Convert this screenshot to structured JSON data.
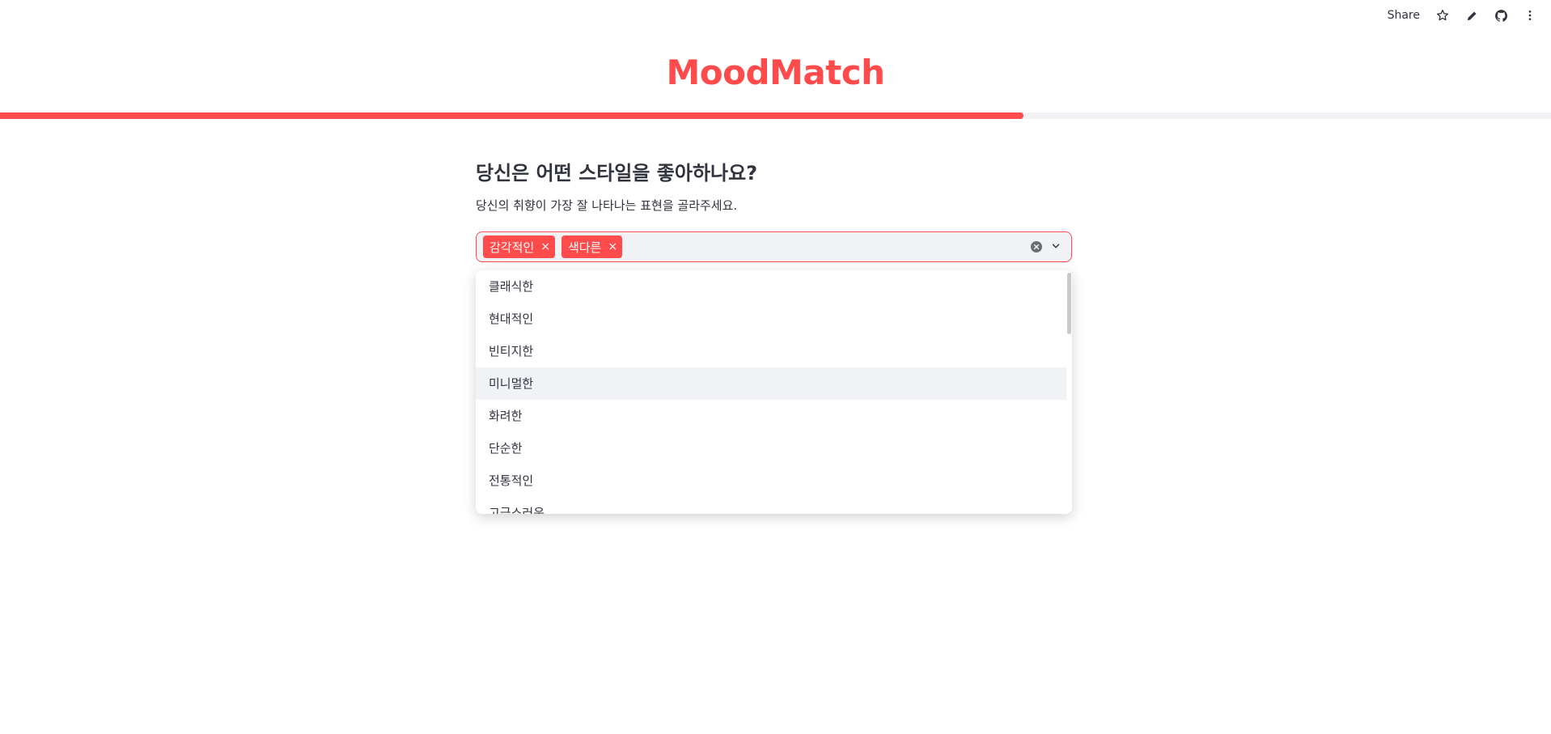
{
  "toolbar": {
    "share_label": "Share",
    "icons": [
      "star-icon",
      "pencil-icon",
      "github-icon",
      "more-vertical-icon"
    ]
  },
  "brand": {
    "title": "MoodMatch",
    "color": "#FF4B4B"
  },
  "progress": {
    "fraction": 0.66
  },
  "question": {
    "title": "당신은 어떤 스타일을 좋아하나요?",
    "subtitle": "당신의 취향이 가장 잘 나타나는 표현을 골라주세요."
  },
  "multiselect": {
    "selected": [
      "감각적인",
      "색다른"
    ],
    "chip_remove_glyph": "×",
    "accent": "#FF4B4B"
  },
  "dropdown": {
    "options": [
      "클래식한",
      "현대적인",
      "빈티지한",
      "미니멀한",
      "화려한",
      "단순한",
      "전통적인",
      "고급스러운"
    ],
    "highlighted_index": 3
  }
}
